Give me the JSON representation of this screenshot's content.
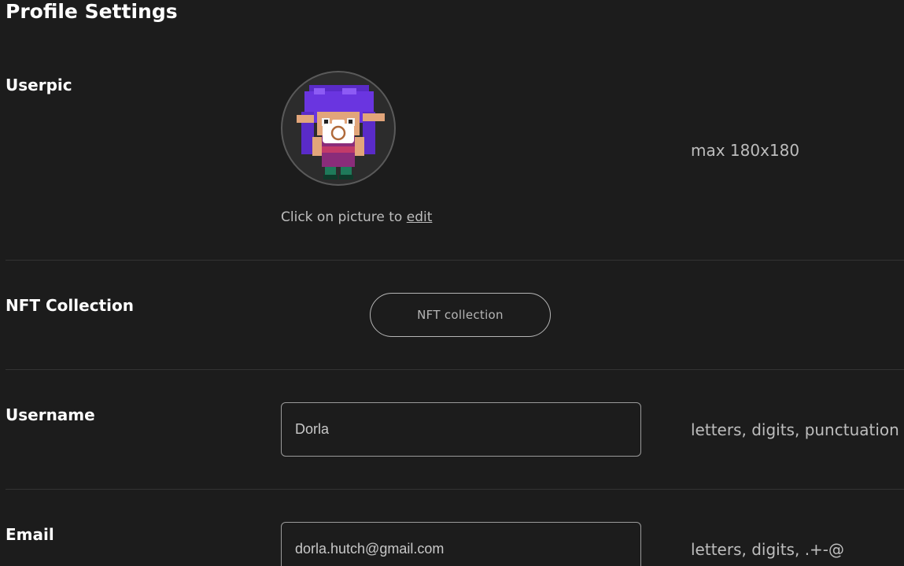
{
  "page": {
    "title": "Profile Settings"
  },
  "userpic": {
    "label": "Userpic",
    "caption_prefix": "Click on picture to ",
    "caption_link": "edit",
    "hint": "max 180x180",
    "icon": "camera-icon"
  },
  "nft": {
    "label": "NFT Collection",
    "button_label": "NFT collection"
  },
  "username": {
    "label": "Username",
    "value": "Dorla",
    "hint": "letters, digits, punctuation"
  },
  "email": {
    "label": "Email",
    "value": "dorla.hutch@gmail.com",
    "hint": "letters, digits, .+-@"
  },
  "colors": {
    "background": "#1c1c1c",
    "text": "#ffffff",
    "muted": "#bdbdbd",
    "border": "#9a9a9a"
  }
}
